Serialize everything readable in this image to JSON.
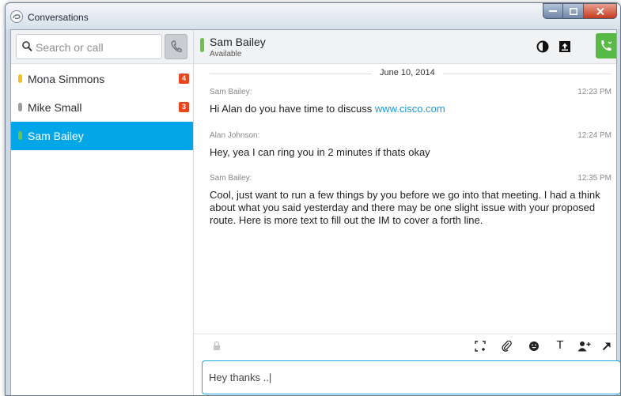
{
  "window": {
    "title": "Conversations"
  },
  "search": {
    "placeholder": "Search or call"
  },
  "contacts": [
    {
      "name": "Mona Simmons",
      "badge": "4",
      "status_color": "#f4c21b"
    },
    {
      "name": "Mike Small",
      "badge": "3",
      "status_color": "#9a9da1"
    },
    {
      "name": "Sam Bailey",
      "badge": "",
      "status_color": "#6cc24a",
      "selected": true
    }
  ],
  "conversation": {
    "name": "Sam Bailey",
    "status": "Available",
    "date": "June 10, 2014",
    "messages": [
      {
        "sender": "Sam Bailey:",
        "time": "12:23 PM",
        "text": "Hi Alan do you have time to discuss ",
        "link": "www.cisco.com"
      },
      {
        "sender": "Alan Johnson:",
        "time": "12:24 PM",
        "text": "Hey, yea I can ring you in 2 minutes if thats okay"
      },
      {
        "sender": "Sam Bailey:",
        "time": "12:35 PM",
        "text": "Cool, just want to run a few things by you before we go into that meeting. I had a think about what you said yesterday and there may be one slight issue with your proposed route. Here is more text to fill out the IM to cover a forth line."
      }
    ]
  },
  "compose": {
    "value": "Hey thanks ..|"
  },
  "toolbar": {
    "text_format_glyph": "T"
  },
  "colors": {
    "accent": "#03a7e8",
    "badge": "#e8461e",
    "call_green": "#58b947",
    "available": "#6cc24a"
  }
}
